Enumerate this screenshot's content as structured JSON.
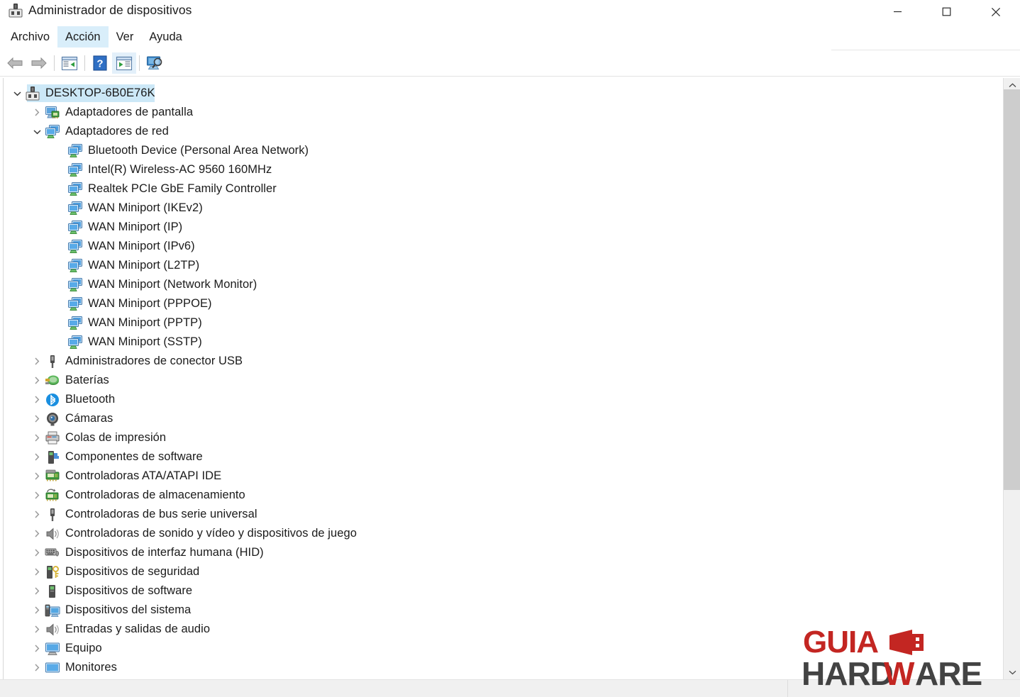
{
  "window": {
    "title": "Administrador de dispositivos",
    "icon": "device-manager-icon",
    "controls": {
      "minimize": "minimize-icon",
      "maximize": "maximize-icon",
      "close": "close-icon"
    }
  },
  "menubar": {
    "items": [
      {
        "label": "Archivo",
        "active": false
      },
      {
        "label": "Acción",
        "active": true
      },
      {
        "label": "Ver",
        "active": false
      },
      {
        "label": "Ayuda",
        "active": false
      }
    ]
  },
  "toolbar": {
    "buttons": [
      {
        "name": "back-arrow-icon",
        "highlighted": false
      },
      {
        "name": "forward-arrow-icon",
        "highlighted": false
      },
      {
        "name": "properties-panel-icon",
        "highlighted": false
      },
      {
        "name": "help-question-icon",
        "highlighted": false
      },
      {
        "name": "show-hidden-panel-icon",
        "highlighted": true
      },
      {
        "name": "scan-hardware-changes-icon",
        "highlighted": false
      }
    ]
  },
  "tree": {
    "root": {
      "label": "DESKTOP-6B0E76K",
      "icon": "computer-icon",
      "expanded": true,
      "selected": true
    },
    "nodes": [
      {
        "label": "Adaptadores de pantalla",
        "icon": "display-adapter-icon",
        "level": 1,
        "expanded": false
      },
      {
        "label": "Adaptadores de red",
        "icon": "network-adapter-icon",
        "level": 1,
        "expanded": true
      },
      {
        "label": "Bluetooth Device (Personal Area Network)",
        "icon": "network-device-icon",
        "level": 2
      },
      {
        "label": "Intel(R) Wireless-AC 9560 160MHz",
        "icon": "network-device-icon",
        "level": 2
      },
      {
        "label": "Realtek PCIe GbE Family Controller",
        "icon": "network-device-icon",
        "level": 2
      },
      {
        "label": "WAN Miniport (IKEv2)",
        "icon": "network-device-icon",
        "level": 2
      },
      {
        "label": "WAN Miniport (IP)",
        "icon": "network-device-icon",
        "level": 2
      },
      {
        "label": "WAN Miniport (IPv6)",
        "icon": "network-device-icon",
        "level": 2
      },
      {
        "label": "WAN Miniport (L2TP)",
        "icon": "network-device-icon",
        "level": 2
      },
      {
        "label": "WAN Miniport (Network Monitor)",
        "icon": "network-device-icon",
        "level": 2
      },
      {
        "label": "WAN Miniport (PPPOE)",
        "icon": "network-device-icon",
        "level": 2
      },
      {
        "label": "WAN Miniport (PPTP)",
        "icon": "network-device-icon",
        "level": 2
      },
      {
        "label": "WAN Miniport (SSTP)",
        "icon": "network-device-icon",
        "level": 2
      },
      {
        "label": "Administradores de conector USB",
        "icon": "usb-connector-icon",
        "level": 1,
        "expanded": false
      },
      {
        "label": "Baterías",
        "icon": "battery-icon",
        "level": 1,
        "expanded": false
      },
      {
        "label": "Bluetooth",
        "icon": "bluetooth-icon",
        "level": 1,
        "expanded": false
      },
      {
        "label": "Cámaras",
        "icon": "camera-icon",
        "level": 1,
        "expanded": false
      },
      {
        "label": "Colas de impresión",
        "icon": "printer-icon",
        "level": 1,
        "expanded": false
      },
      {
        "label": "Componentes de software",
        "icon": "software-component-icon",
        "level": 1,
        "expanded": false
      },
      {
        "label": "Controladoras ATA/ATAPI IDE",
        "icon": "ide-controller-icon",
        "level": 1,
        "expanded": false
      },
      {
        "label": "Controladoras de almacenamiento",
        "icon": "storage-controller-icon",
        "level": 1,
        "expanded": false
      },
      {
        "label": "Controladoras de bus serie universal",
        "icon": "usb-controller-icon",
        "level": 1,
        "expanded": false
      },
      {
        "label": "Controladoras de sonido y vídeo y dispositivos de juego",
        "icon": "sound-controller-icon",
        "level": 1,
        "expanded": false
      },
      {
        "label": "Dispositivos de interfaz humana (HID)",
        "icon": "hid-device-icon",
        "level": 1,
        "expanded": false
      },
      {
        "label": "Dispositivos de seguridad",
        "icon": "security-device-icon",
        "level": 1,
        "expanded": false
      },
      {
        "label": "Dispositivos de software",
        "icon": "software-device-icon",
        "level": 1,
        "expanded": false
      },
      {
        "label": "Dispositivos del sistema",
        "icon": "system-device-icon",
        "level": 1,
        "expanded": false
      },
      {
        "label": "Entradas y salidas de audio",
        "icon": "audio-io-icon",
        "level": 1,
        "expanded": false
      },
      {
        "label": "Equipo",
        "icon": "computer-monitor-icon",
        "level": 1,
        "expanded": false
      },
      {
        "label": "Monitores",
        "icon": "monitor-icon",
        "level": 1,
        "expanded": false
      }
    ]
  },
  "scrollbars": {
    "vertical": {
      "up_arrow": "chevron-up-icon",
      "down_arrow": "chevron-down-icon"
    },
    "horizontal": {
      "present": true
    }
  },
  "watermark": {
    "line1": "GUIA",
    "line2": "HARDWARE",
    "accent_color": "#c2201b",
    "dark_color": "#3d3d3d"
  },
  "colors": {
    "selection": "#cce8f7",
    "menu_hover": "#d9eefa",
    "text": "#1b1b1b",
    "title_text": "#1a1a1a",
    "scrollbar_thumb": "#cdcdcd",
    "scrollbar_track": "#f0f0f0"
  }
}
